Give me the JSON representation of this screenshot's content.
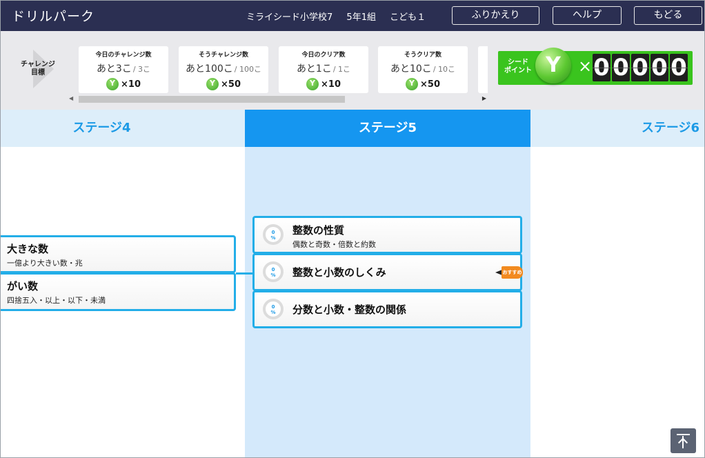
{
  "header": {
    "app_title": "ドリルパーク",
    "school": "ミライシード小学校7",
    "class": "5年1組",
    "user": "こども１",
    "review_button": "ふりかえり",
    "help_button": "ヘルプ",
    "back_button": "もどる"
  },
  "challenge": {
    "goal_label_line1": "チャレンジ",
    "goal_label_line2": "目標",
    "cards": [
      {
        "title": "今日のチャレンジ数",
        "remaining": "あと3こ",
        "total": "/ 3こ",
        "reward": "×10"
      },
      {
        "title": "そうチャレンジ数",
        "remaining": "あと100こ",
        "total": "/ 100こ",
        "reward": "×50"
      },
      {
        "title": "今日のクリア数",
        "remaining": "あと1こ",
        "total": "/ 1こ",
        "reward": "×10"
      },
      {
        "title": "そうクリア数",
        "remaining": "あと10こ",
        "total": "/ 10こ",
        "reward": "×50"
      }
    ],
    "scroll_left_icon": "triangle-left-icon",
    "scroll_right_icon": "triangle-right-icon"
  },
  "seed_point": {
    "label_line1": "シード",
    "label_line2": "ポイント",
    "times": "×",
    "digits": [
      "0",
      "0",
      "0",
      "0",
      "0"
    ],
    "accent_color": "#3ac41e"
  },
  "stages": {
    "stage4": "ステージ4",
    "stage5": "ステージ5",
    "stage6": "ステージ6",
    "active_color": "#1596f0"
  },
  "stage4_units": [
    {
      "title": "大きな数",
      "subtitle": "一億より大きい数・兆"
    },
    {
      "title": "がい数",
      "subtitle": "四捨五入・以上・以下・未満"
    }
  ],
  "stage5_units": [
    {
      "title": "整数の性質",
      "subtitle": "偶数と奇数・倍数と約数",
      "progress": "0\n%"
    },
    {
      "title": "整数と小数のしくみ",
      "subtitle": "",
      "progress": "0\n%"
    },
    {
      "title": "分数と小数・整数の関係",
      "subtitle": "",
      "progress": "0\n%"
    }
  ],
  "recommend_label": "おすすめ",
  "scroll_top_icon": "scroll-to-top-icon"
}
